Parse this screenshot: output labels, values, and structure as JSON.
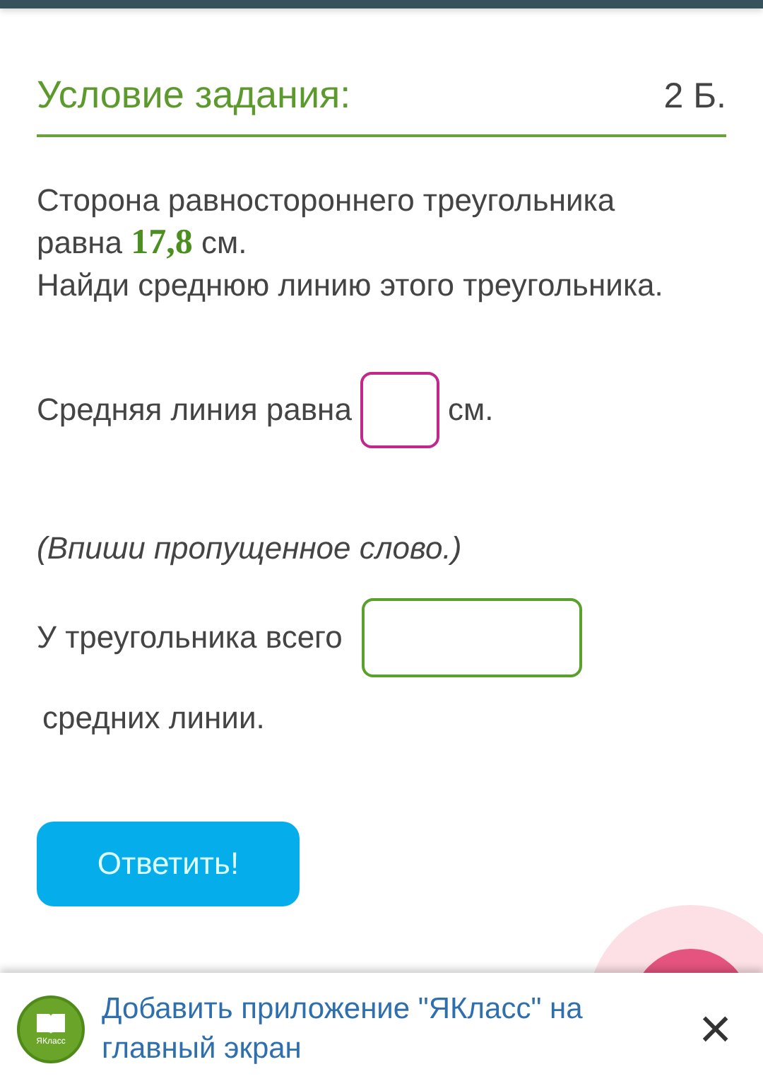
{
  "task": {
    "title": "Условие задания:",
    "points": "2 Б."
  },
  "statement": {
    "before": "Сторона равностороннего треугольника равна ",
    "value": "17,8",
    "after": " см."
  },
  "instruction": "Найди среднюю линию этого треугольника.",
  "question1": {
    "before": "Средняя линия равна",
    "field": {
      "focused": true
    },
    "after": "см."
  },
  "hint": "(Впиши пропущенное слово.)",
  "question2": {
    "before": "У треугольника всего",
    "field": {
      "focused": false
    },
    "after": "средних линии."
  },
  "submit": "Ответить!",
  "banner": {
    "logo_text": "ЯКласс",
    "text": "Добавить приложение \"ЯКласс\" на главный экран",
    "close": "×"
  }
}
